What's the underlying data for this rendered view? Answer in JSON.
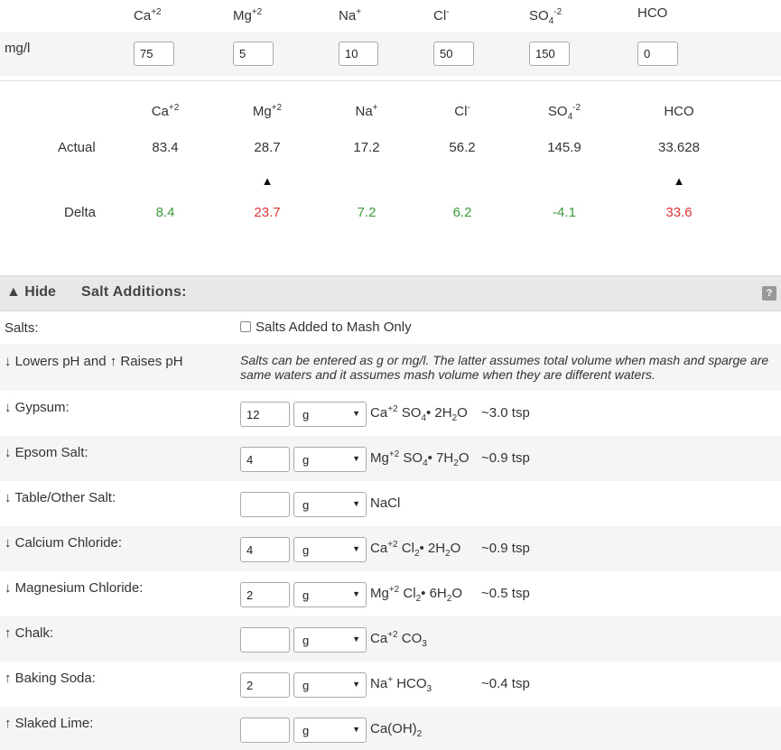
{
  "ions": {
    "ca": {
      "base": "Ca",
      "sup": "+2"
    },
    "mg": {
      "base": "Mg",
      "sup": "+2"
    },
    "na": {
      "base": "Na",
      "sup": "+"
    },
    "cl": {
      "base": "Cl",
      "sup": "-"
    },
    "so4": {
      "base": "SO",
      "sub": "4",
      "sup": "-2"
    },
    "hco": {
      "base": "HCO"
    }
  },
  "target": {
    "unit_label": "mg/l",
    "values": {
      "ca": "75",
      "mg": "5",
      "na": "10",
      "cl": "50",
      "so4": "150",
      "hco": "0"
    }
  },
  "results": {
    "actual_label": "Actual",
    "delta_label": "Delta",
    "actual": {
      "ca": "83.4",
      "mg": "28.7",
      "na": "17.2",
      "cl": "56.2",
      "so4": "145.9",
      "hco": "33.628"
    },
    "delta": {
      "ca": "8.4",
      "mg": "23.7",
      "na": "7.2",
      "cl": "6.2",
      "so4": "-4.1",
      "hco": "33.6"
    },
    "warning_arrow": "▲",
    "colors": {
      "positive_ok": "#3a9a3a",
      "warning": "#dd3333"
    }
  },
  "salts_section": {
    "toggle_label": "▲ Hide",
    "title": "Salt Additions:",
    "help_label": "?",
    "salts_label": "Salts:",
    "mash_only_label": "Salts Added to Mash Only",
    "ph_label": "↓ Lowers pH and ↑ Raises pH",
    "note": "Salts can be entered as g or mg/l. The latter assumes total volume when mash and sparge are same waters and it assumes mash volume when they are different waters.",
    "rows": [
      {
        "label": "↓ Gypsum:",
        "amount": "12",
        "unit": "g",
        "tsp": "~3.0 tsp"
      },
      {
        "label": "↓ Epsom Salt:",
        "amount": "4",
        "unit": "g",
        "tsp": "~0.9 tsp"
      },
      {
        "label": "↓ Table/Other Salt:",
        "amount": "",
        "unit": "g",
        "formula_text": "NaCl",
        "tsp": ""
      },
      {
        "label": "↓ Calcium Chloride:",
        "amount": "4",
        "unit": "g",
        "tsp": "~0.9 tsp"
      },
      {
        "label": "↓ Magnesium Chloride:",
        "amount": "2",
        "unit": "g",
        "tsp": "~0.5 tsp"
      },
      {
        "label": "↑ Chalk:",
        "amount": "",
        "unit": "g",
        "tsp": ""
      },
      {
        "label": "↑ Baking Soda:",
        "amount": "2",
        "unit": "g",
        "tsp": "~0.4 tsp"
      },
      {
        "label": "↑ Slaked Lime:",
        "amount": "",
        "unit": "g",
        "tsp": ""
      }
    ],
    "formula_parts": {
      "gypsum": [
        "Ca",
        "+2",
        "SO",
        "4",
        "• 2H",
        "2",
        "O"
      ],
      "epsom": [
        "Mg",
        "+2",
        "SO",
        "4",
        "• 7H",
        "2",
        "O"
      ],
      "cacl": [
        "Ca",
        "+2",
        "Cl",
        "2",
        "• 2H",
        "2",
        "O"
      ],
      "mgcl": [
        "Mg",
        "+2",
        "Cl",
        "2",
        "• 6H",
        "2",
        "O"
      ],
      "chalk": [
        "Ca",
        "+2",
        "CO",
        "3"
      ],
      "soda": [
        "Na",
        "+",
        "HCO",
        "3"
      ],
      "lime": [
        "Ca(OH)",
        "2"
      ]
    }
  }
}
